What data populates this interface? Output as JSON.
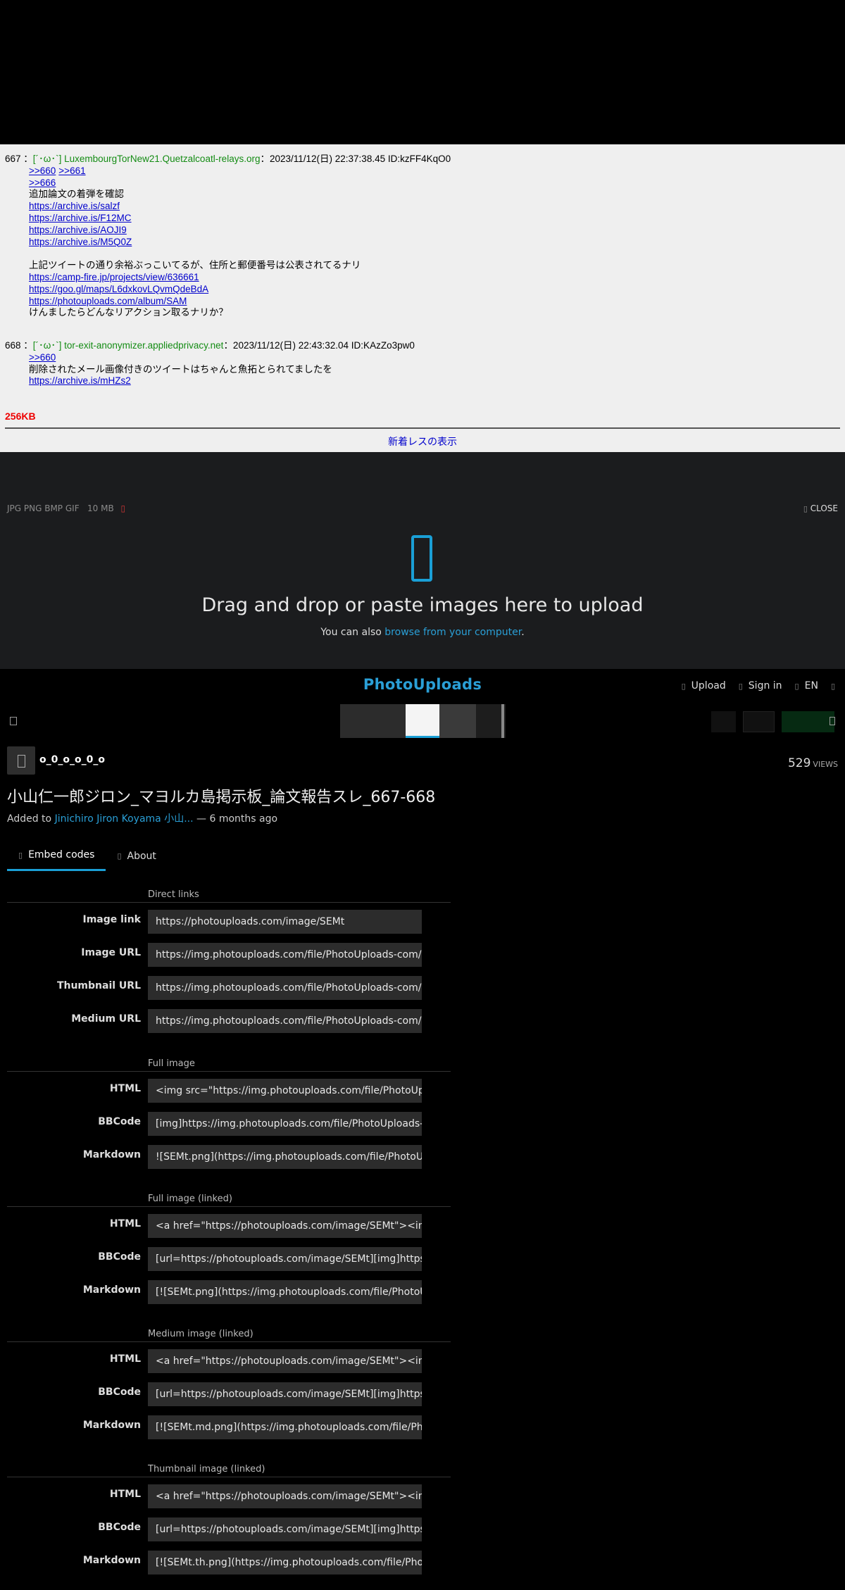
{
  "thread": {
    "posts": [
      {
        "num": "667",
        "sep": "：",
        "name": "[´･ω･`] LuxembourgTorNew21.Quetzalcoatl-relays.org",
        "meta": "：2023/11/12(日) 22:37:38.45 ID:kzFF4KqO0",
        "links_top": [
          ">>660",
          ">>661"
        ],
        "link_666": ">>666",
        "line1": "追加論文の着弾を確認",
        "archives": [
          "https://archive.is/salzf",
          "https://archive.is/F12MC",
          "https://archive.is/AOJI9",
          "https://archive.is/M5Q0Z"
        ],
        "line2": "上記ツイートの通り余裕ぶっこいてるが、住所と郵便番号は公表されてるナリ",
        "links2": [
          "https://camp-fire.jp/projects/view/636661",
          "https://goo.gl/maps/L6dxkovLQvmQdeBdA",
          "https://photouploads.com/album/SAM"
        ],
        "line3": "けんましたらどんなリアクション取るナリか？"
      },
      {
        "num": "668",
        "sep": "：",
        "name": "[´･ω･`] tor-exit-anonymizer.appliedprivacy.net",
        "meta": "：2023/11/12(日) 22:43:32.04 ID:KAzZo3pw0",
        "link": ">>660",
        "line1": "削除されたメール画像付きのツイートはちゃんと魚拓とられてましたを",
        "archive": "https://archive.is/mHZs2"
      }
    ],
    "size": "256KB",
    "new_res": "新着レスの表示"
  },
  "upload": {
    "formats": "JPG PNG BMP GIF",
    "max_size": "10 MB",
    "close": "CLOSE",
    "title": "Drag and drop or paste images here to upload",
    "sub_prefix": "You can also ",
    "sub_link": "browse from your computer",
    "sub_suffix": "."
  },
  "header": {
    "logo": "PhotoUploads",
    "upload": "Upload",
    "signin": "Sign in",
    "lang": "EN"
  },
  "image": {
    "username": "o_0_o_o_0_o",
    "views": "529",
    "views_label": "VIEWS",
    "title": "小山仁一郎ジロン_マヨルカ島掲示板_論文報告スレ_667-668",
    "added_prefix": "Added to ",
    "album": "Jinichiro Jiron Koyama 小山...",
    "added_suffix": " — 6 months ago"
  },
  "tabs": {
    "embed": "Embed codes",
    "about": "About"
  },
  "embed": {
    "sections": [
      {
        "title": "Direct links",
        "rows": [
          {
            "label": "Image link",
            "value": "https://photouploads.com/image/SEMt"
          },
          {
            "label": "Image URL",
            "value": "https://img.photouploads.com/file/PhotoUploads-com/SEMt.png"
          },
          {
            "label": "Thumbnail URL",
            "value": "https://img.photouploads.com/file/PhotoUploads-com/SEMt.th.png"
          },
          {
            "label": "Medium URL",
            "value": "https://img.photouploads.com/file/PhotoUploads-com/SEMt.md.png"
          }
        ]
      },
      {
        "title": "Full image",
        "rows": [
          {
            "label": "HTML",
            "value": "<img src=\"https://img.photouploads.com/file/PhotoUploads-com/SEMt.png\">"
          },
          {
            "label": "BBCode",
            "value": "[img]https://img.photouploads.com/file/PhotoUploads-com/SEMt.png[/img]"
          },
          {
            "label": "Markdown",
            "value": "![SEMt.png](https://img.photouploads.com/file/PhotoUploads-com/SEMt.png)"
          }
        ]
      },
      {
        "title": "Full image (linked)",
        "rows": [
          {
            "label": "HTML",
            "value": "<a href=\"https://photouploads.com/image/SEMt\"><img src=\"https://img.photouploads.com/file/PhotoUploads-com/SEMt.png\"></a>"
          },
          {
            "label": "BBCode",
            "value": "[url=https://photouploads.com/image/SEMt][img]https://img.photouploads.com/file/PhotoUploads-com/SEMt.png[/img][/url]"
          },
          {
            "label": "Markdown",
            "value": "[![SEMt.png](https://img.photouploads.com/file/PhotoUploads-com/SEMt.png)](https://photouploads.com/image/SEMt)"
          }
        ]
      },
      {
        "title": "Medium image (linked)",
        "rows": [
          {
            "label": "HTML",
            "value": "<a href=\"https://photouploads.com/image/SEMt\"><img src=\"https://img.photouploads.com/file/PhotoUploads-com/SEMt.md.png\"></a>"
          },
          {
            "label": "BBCode",
            "value": "[url=https://photouploads.com/image/SEMt][img]https://img.photouploads.com/file/PhotoUploads-com/SEMt.md.png[/img][/url]"
          },
          {
            "label": "Markdown",
            "value": "[![SEMt.md.png](https://img.photouploads.com/file/PhotoUploads-com/SEMt.md.png)](https://photouploads.com/image/SEMt)"
          }
        ]
      },
      {
        "title": "Thumbnail image (linked)",
        "rows": [
          {
            "label": "HTML",
            "value": "<a href=\"https://photouploads.com/image/SEMt\"><img src=\"https://img.photouploads.com/file/PhotoUploads-com/SEMt.th.png\"></a>"
          },
          {
            "label": "BBCode",
            "value": "[url=https://photouploads.com/image/SEMt][img]https://img.photouploads.com/file/PhotoUploads-com/SEMt.th.png[/img][/url]"
          },
          {
            "label": "Markdown",
            "value": "[![SEMt.th.png](https://img.photouploads.com/file/PhotoUploads-com/SEMt.th.png)](https://photouploads.com/image/SEMt)"
          }
        ]
      }
    ]
  }
}
